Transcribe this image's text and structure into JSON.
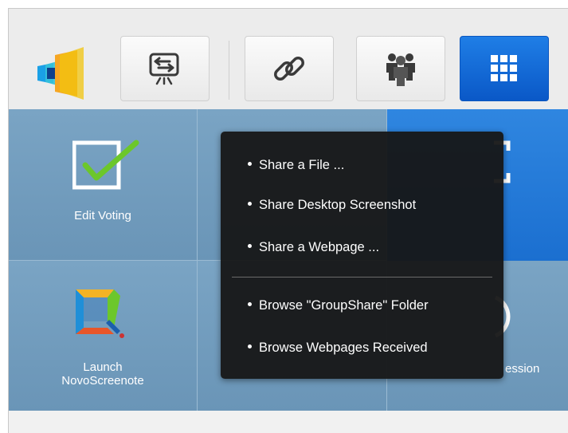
{
  "window_controls": {
    "minimize_icon": "minimize-icon",
    "close_icon": "close-icon"
  },
  "toolbar": {
    "logo_icon": "app-logo-icon",
    "buttons": [
      {
        "name": "screen-share-button",
        "icon": "presentation-screen-icon"
      },
      {
        "name": "link-button",
        "icon": "link-icon"
      },
      {
        "name": "group-button",
        "icon": "group-users-icon"
      },
      {
        "name": "apps-button",
        "icon": "grid-apps-icon",
        "active": true
      }
    ]
  },
  "tiles": [
    {
      "label": "Edit Voting",
      "icon": "checkbox-check-icon"
    },
    {
      "label": "",
      "icon": ""
    },
    {
      "label": "",
      "icon": "fullscreen-icon"
    },
    {
      "label": "Launch\nNovoScreenote",
      "icon": "screenote-icon"
    },
    {
      "label": "",
      "icon": ""
    },
    {
      "label": "ession",
      "icon": "power-icon"
    }
  ],
  "context_menu": {
    "items_top": [
      "Share a File ...",
      "Share Desktop Screenshot",
      "Share a Webpage ..."
    ],
    "items_bottom": [
      "Browse \"GroupShare\" Folder",
      "Browse Webpages Received"
    ]
  },
  "colors": {
    "accent": "#1b6fd0",
    "tile": "#7aa4c4",
    "menu_bg": "#161616"
  }
}
